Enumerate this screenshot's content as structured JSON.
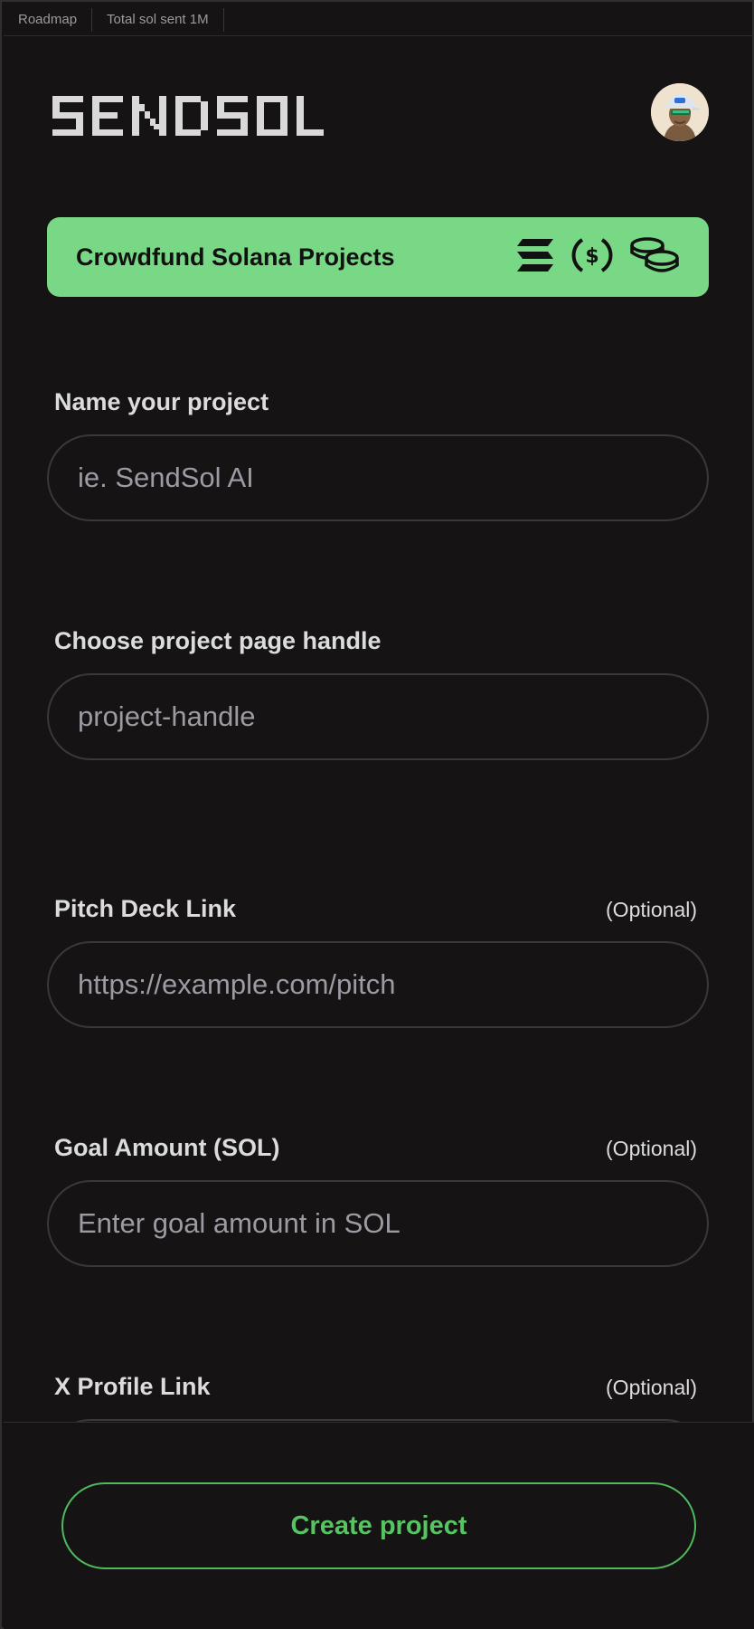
{
  "nav": {
    "items": [
      "Roadmap",
      "Total sol sent 1M"
    ]
  },
  "header": {
    "brand": "SENDSOL",
    "avatar_icon": "user-avatar-icon"
  },
  "banner": {
    "title": "Crowdfund Solana Projects",
    "icons": [
      "solana-logo-icon",
      "dollar-coin-icon",
      "coin-stack-icon"
    ],
    "background": "#79d885"
  },
  "form": {
    "project_name": {
      "label": "Name your project",
      "placeholder": "ie. SendSol AI",
      "value": ""
    },
    "handle": {
      "label": "Choose project page handle",
      "placeholder": "project-handle",
      "value": ""
    },
    "pitch_deck": {
      "label": "Pitch Deck Link",
      "optional": "(Optional)",
      "placeholder": "https://example.com/pitch",
      "value": ""
    },
    "goal": {
      "label": "Goal Amount (SOL)",
      "optional": "(Optional)",
      "placeholder": "Enter goal amount in SOL",
      "value": ""
    },
    "x_profile": {
      "label": "X Profile Link",
      "optional": "(Optional)",
      "placeholder": "",
      "value": ""
    }
  },
  "footer": {
    "create_label": "Create project",
    "accent": "#56c462"
  }
}
